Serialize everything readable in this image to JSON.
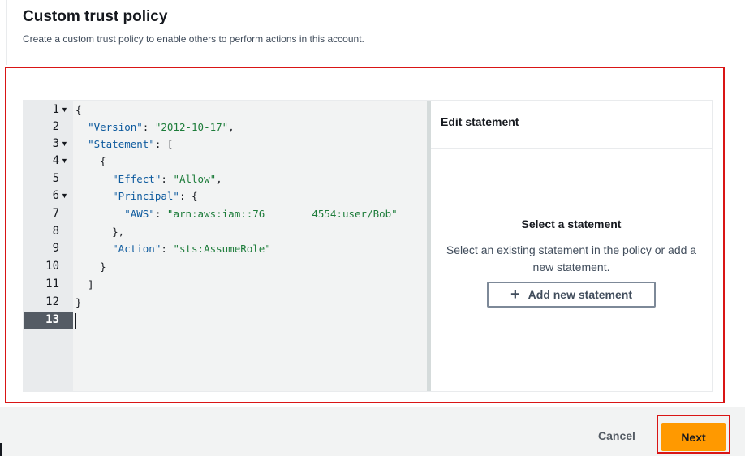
{
  "header": {
    "title": "Custom trust policy",
    "subtitle": "Create a custom trust policy to enable others to perform actions in this account."
  },
  "editor": {
    "lines": [
      {
        "n": "1",
        "fold": true
      },
      {
        "n": "2",
        "fold": false
      },
      {
        "n": "3",
        "fold": true
      },
      {
        "n": "4",
        "fold": true
      },
      {
        "n": "5",
        "fold": false
      },
      {
        "n": "6",
        "fold": true
      },
      {
        "n": "7",
        "fold": false
      },
      {
        "n": "8",
        "fold": false
      },
      {
        "n": "9",
        "fold": false
      },
      {
        "n": "10",
        "fold": false
      },
      {
        "n": "11",
        "fold": false
      },
      {
        "n": "12",
        "fold": false
      },
      {
        "n": "13",
        "fold": false
      }
    ],
    "active_line": "13",
    "code": {
      "version_key": "\"Version\"",
      "version_value": "\"2012-10-17\"",
      "statement_key": "\"Statement\"",
      "effect_key": "\"Effect\"",
      "effect_value": "\"Allow\"",
      "principal_key": "\"Principal\"",
      "aws_key": "\"AWS\"",
      "aws_value_start": "\"arn:aws:iam::76",
      "aws_value_end": "4554:user/Bob\"",
      "action_key": "\"Action\"",
      "action_value": "\"sts:AssumeRole\""
    }
  },
  "side_panel": {
    "title": "Edit statement",
    "empty_title": "Select a statement",
    "empty_description": "Select an existing statement in the policy or add a new statement.",
    "add_button_label": "Add new statement"
  },
  "footer": {
    "cancel_label": "Cancel",
    "next_label": "Next"
  },
  "colors": {
    "primary_button": "#ff9900",
    "highlight_border": "#d91515",
    "json_key": "#0d5a9e",
    "json_string": "#1d7c3a"
  }
}
